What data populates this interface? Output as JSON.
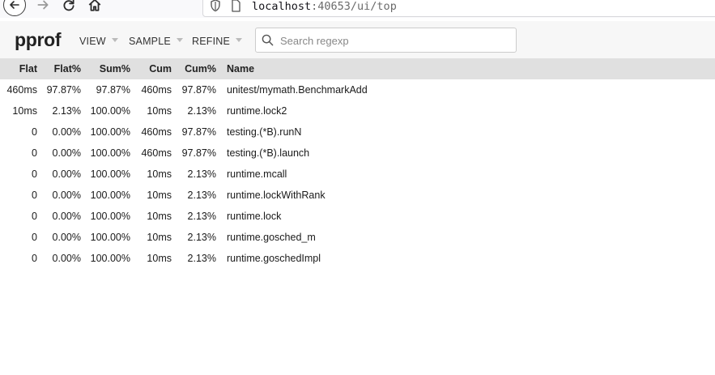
{
  "browser": {
    "url_host": "localhost",
    "url_rest": ":40653/ui/top"
  },
  "app": {
    "title": "pprof",
    "menu": [
      {
        "label": "VIEW"
      },
      {
        "label": "SAMPLE"
      },
      {
        "label": "REFINE"
      }
    ],
    "search": {
      "placeholder": "Search regexp",
      "value": ""
    }
  },
  "table": {
    "columns": [
      "Flat",
      "Flat%",
      "Sum%",
      "Cum",
      "Cum%",
      "Name"
    ],
    "rows": [
      {
        "flat": "460ms",
        "flat_pct": "97.87%",
        "sum_pct": "97.87%",
        "cum": "460ms",
        "cum_pct": "97.87%",
        "name": "unitest/mymath.BenchmarkAdd"
      },
      {
        "flat": "10ms",
        "flat_pct": "2.13%",
        "sum_pct": "100.00%",
        "cum": "10ms",
        "cum_pct": "2.13%",
        "name": "runtime.lock2"
      },
      {
        "flat": "0",
        "flat_pct": "0.00%",
        "sum_pct": "100.00%",
        "cum": "460ms",
        "cum_pct": "97.87%",
        "name": "testing.(*B).runN"
      },
      {
        "flat": "0",
        "flat_pct": "0.00%",
        "sum_pct": "100.00%",
        "cum": "460ms",
        "cum_pct": "97.87%",
        "name": "testing.(*B).launch"
      },
      {
        "flat": "0",
        "flat_pct": "0.00%",
        "sum_pct": "100.00%",
        "cum": "10ms",
        "cum_pct": "2.13%",
        "name": "runtime.mcall"
      },
      {
        "flat": "0",
        "flat_pct": "0.00%",
        "sum_pct": "100.00%",
        "cum": "10ms",
        "cum_pct": "2.13%",
        "name": "runtime.lockWithRank"
      },
      {
        "flat": "0",
        "flat_pct": "0.00%",
        "sum_pct": "100.00%",
        "cum": "10ms",
        "cum_pct": "2.13%",
        "name": "runtime.lock"
      },
      {
        "flat": "0",
        "flat_pct": "0.00%",
        "sum_pct": "100.00%",
        "cum": "10ms",
        "cum_pct": "2.13%",
        "name": "runtime.gosched_m"
      },
      {
        "flat": "0",
        "flat_pct": "0.00%",
        "sum_pct": "100.00%",
        "cum": "10ms",
        "cum_pct": "2.13%",
        "name": "runtime.goschedImpl"
      }
    ]
  }
}
